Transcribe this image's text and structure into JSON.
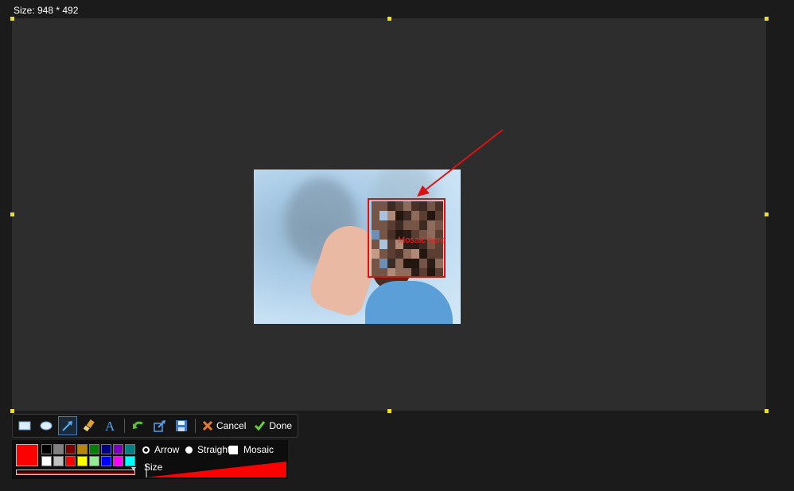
{
  "selection": {
    "size_label": "Size: 948 * 492"
  },
  "annotation": {
    "mosaic_text": "Mosaic here",
    "color": "#e01010"
  },
  "toolbar": {
    "tools": [
      "rectangle",
      "ellipse",
      "arrow",
      "brush",
      "text"
    ],
    "active_tool": "arrow",
    "cancel_label": "Cancel",
    "done_label": "Done"
  },
  "options": {
    "current_color": "#ff0000",
    "palette_row1": [
      "#000000",
      "#808080",
      "#800000",
      "#b8860b",
      "#008000",
      "#000080",
      "#8000c0",
      "#008080"
    ],
    "palette_row2": [
      "#ffffff",
      "#c0c0c0",
      "#ff0000",
      "#ffff00",
      "#90ee90",
      "#0000ff",
      "#ff00ff",
      "#00ffff"
    ],
    "arrow_label": "Arrow",
    "straight_label": "Straight",
    "mosaic_label": "Mosaic",
    "size_label": "Size",
    "selected_mode": "Straight"
  }
}
